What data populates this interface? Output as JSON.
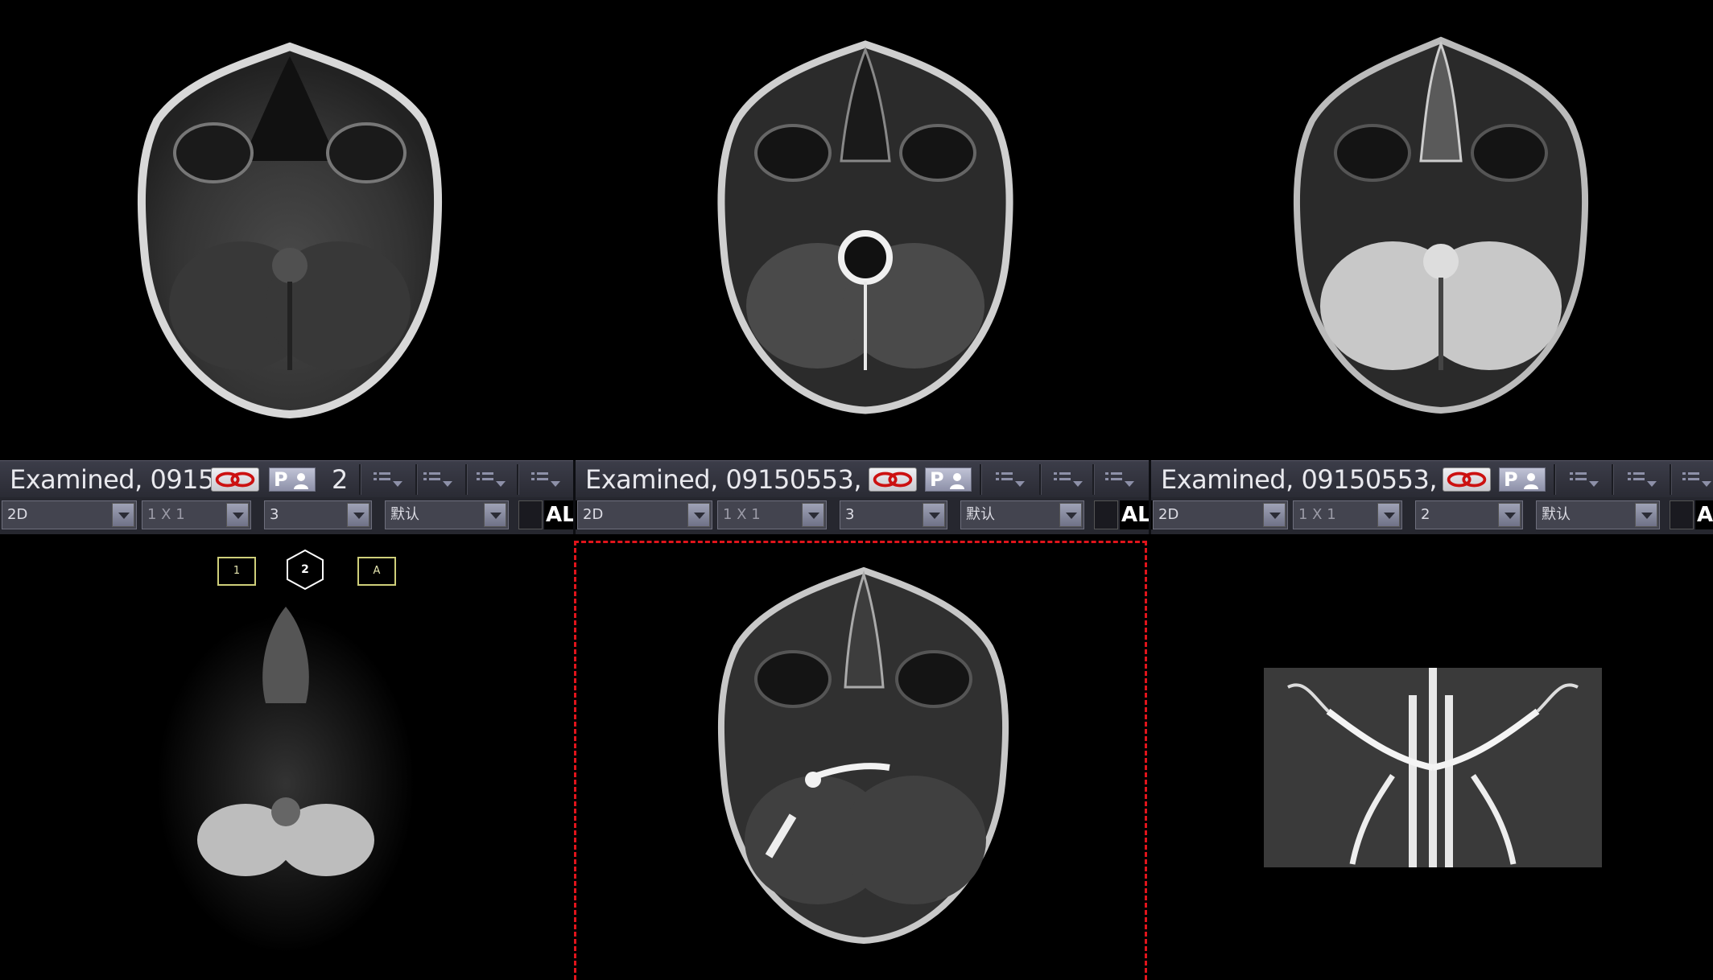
{
  "viewports": [
    {
      "exam_text": "Examined, 0915(",
      "series_number": "2",
      "mode": "2D",
      "layout": "1 X 1",
      "slice": "3",
      "preset": "默认",
      "tool_label": "AL"
    },
    {
      "exam_text": "Examined, 09150553, 5",
      "mode": "2D",
      "layout": "1 X 1",
      "slice": "3",
      "preset": "默认",
      "tool_label": "AL"
    },
    {
      "exam_text": "Examined, 09150553, 5",
      "mode": "2D",
      "layout": "1 X 1",
      "slice": "2",
      "preset": "默认",
      "tool_label": "A"
    }
  ],
  "buttons": {
    "link_icon": "link-chain-icon",
    "patient_label": "P",
    "patient_icon": "person-icon",
    "list_icon": "list-dropdown-icon"
  },
  "overlay": {
    "box1": "1",
    "box2": "2",
    "box3": "A"
  },
  "colors": {
    "active_border": "#e0141b",
    "toolbar_bg": "#26272f",
    "overlay_box": "#cfcf7a"
  }
}
